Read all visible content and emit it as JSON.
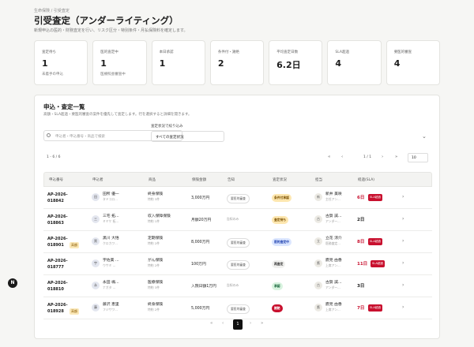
{
  "breadcrumb": "生命保険 / 引受査定",
  "page_title": "引受査定（アンダーライティング）",
  "page_desc": "新規申込の医的・財務査定を行い、リスク区分・特別条件・月払保険料を確定します。",
  "stats": [
    {
      "label": "査定待ち",
      "value": "1",
      "note": "未着手の申込"
    },
    {
      "label": "医的査定中",
      "value": "1",
      "note": "医療照会審査中"
    },
    {
      "label": "本日承認",
      "value": "1",
      "note": ""
    },
    {
      "label": "条件付・謝絶",
      "value": "2",
      "note": ""
    },
    {
      "label": "平均査定日数",
      "value": "6.2日",
      "note": ""
    },
    {
      "label": "SLA超過",
      "value": "4",
      "note": ""
    },
    {
      "label": "要医的審査",
      "value": "4",
      "note": ""
    }
  ],
  "list": {
    "title": "申込・査定一覧",
    "desc": "高額・SLA超過・要医的審査の案件を優先して査定します。行を選択すると詳細を開きます。",
    "search_placeholder": "申込者・申込番号・商品で検索",
    "filter_label": "査定状況で絞り込み",
    "filter_value": "すべての査定状況",
    "filter_chevron": "⌄",
    "count_text": "1 - 6 / 6",
    "page_text": "1 / 1",
    "page_size": "10",
    "nav": {
      "first": "«",
      "prev": "‹",
      "next": "›",
      "last": "»"
    },
    "columns": [
      "申込番号",
      "申込者",
      "商品",
      "保険金額",
      "告知",
      "査定状況",
      "担当",
      "経過(SLA)"
    ],
    "rows": [
      {
        "id": "AP-2026-\n018842",
        "badge": "",
        "av": "田",
        "name": "田所 優一",
        "kana": "タドコロ…",
        "product": "終身保険",
        "term": "特約 3件",
        "amount": "3,000万円",
        "tag": "要医的審査",
        "badge_label": "条件付承認",
        "badge_bg": "#fde7b0",
        "badge_fg": "#7a5000",
        "av2": "新",
        "owner": "新井 美咲",
        "role": "主任アン…",
        "sla": "6日",
        "sla_color": "#c8102e",
        "sla_flag": "SLA超過",
        "arrow": "›"
      },
      {
        "id": "AP-2026-\n018863",
        "badge": "",
        "av": "三",
        "name": "三宅 拓…",
        "kana": "ミヤケ 拓…",
        "product": "収入保障保険",
        "term": "特約 1件",
        "amount": "月額20万円",
        "tag": "告知のみ",
        "badge_label": "査定待ち",
        "badge_bg": "#fde7b0",
        "badge_fg": "#7a5000",
        "av2": "古",
        "owner": "古賀 誠…",
        "role": "アンダー…",
        "sla": "2日",
        "sla_color": "#1c1c1c",
        "sla_flag": "",
        "arrow": "›"
      },
      {
        "id": "AP-2026-\n018901",
        "badge": "高額",
        "av": "黒",
        "name": "黒川 大悟",
        "kana": "クロカワ…",
        "product": "定期保険",
        "term": "特約 2件",
        "amount": "8,000万円",
        "tag": "要医的審査",
        "badge_label": "医的査定中",
        "badge_bg": "#dbe6ff",
        "badge_fg": "#1e40af",
        "av2": "立",
        "owner": "立花 涼介",
        "role": "医務査定…",
        "sla": "8日",
        "sla_color": "#c8102e",
        "sla_flag": "SLA超過",
        "arrow": "›"
      },
      {
        "id": "AP-2026-\n018777",
        "badge": "",
        "av": "宇",
        "name": "宇佐美 …",
        "kana": "ウサミ …",
        "product": "がん保険",
        "term": "特約 2件",
        "amount": "100万円",
        "tag": "要医的審査",
        "badge_label": "再査定",
        "badge_bg": "#f0f0ee",
        "badge_fg": "#333",
        "av2": "鷹",
        "owner": "鷹見 由香",
        "role": "上席アン…",
        "sla": "11日",
        "sla_color": "#c8102e",
        "sla_flag": "SLA超過",
        "arrow": "›"
      },
      {
        "id": "AP-2026-\n018810",
        "badge": "",
        "av": "永",
        "name": "永田 颯…",
        "kana": "ナガタ …",
        "product": "医療保険",
        "term": "特約 3件",
        "amount": "入院日額1万円",
        "tag": "告知のみ",
        "badge_label": "承認",
        "badge_bg": "#d8f3df",
        "badge_fg": "#16653a",
        "av2": "古",
        "owner": "古賀 誠…",
        "role": "アンダー…",
        "sla": "3日",
        "sla_color": "#1c1c1c",
        "sla_flag": "",
        "arrow": "›"
      },
      {
        "id": "AP-2026-\n018928",
        "badge": "高額",
        "av": "藤",
        "name": "藤沢 恵里",
        "kana": "フジサワ…",
        "product": "終身保険",
        "term": "特約 2件",
        "amount": "5,000万円",
        "tag": "要医的審査",
        "badge_label": "謝絶",
        "badge_bg": "#c8102e",
        "badge_fg": "#fff",
        "av2": "鷹",
        "owner": "鷹見 由香",
        "role": "上席アン…",
        "sla": "7日",
        "sla_color": "#c8102e",
        "sla_flag": "SLA超過",
        "arrow": "›"
      }
    ],
    "current_page": "1"
  },
  "fab_label": "N"
}
